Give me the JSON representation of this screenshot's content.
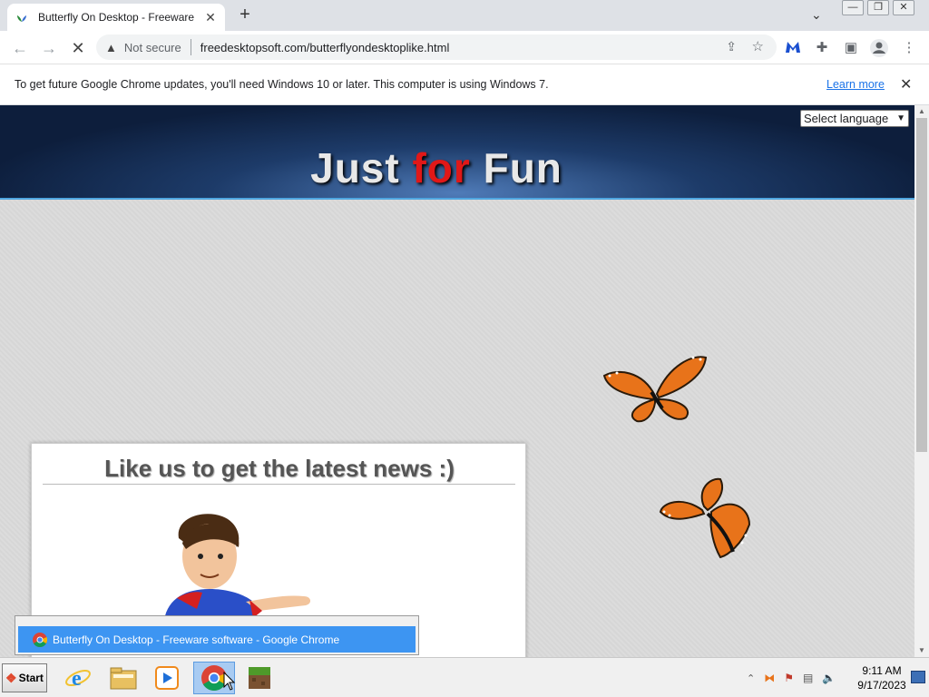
{
  "browser": {
    "tab_title": "Butterfly On Desktop - Freeware",
    "tab_close": "✕",
    "new_tab": "+",
    "tab_list": "⌄",
    "address_security": "Not secure",
    "address_url": "freedesktopsoft.com/butterflyondesktoplike.html"
  },
  "infobar": {
    "message": "To get future Google Chrome updates, you'll need Windows 10 or later. This computer is using Windows 7.",
    "link": "Learn more",
    "close": "✕"
  },
  "page": {
    "banner_words": [
      "Just",
      "for",
      "Fun"
    ],
    "language_select": "Select language",
    "card_heading": "Like us to get the latest news :)"
  },
  "tooltip": {
    "label": "Butterfly On Desktop - Freeware software - Google Chrome"
  },
  "taskbar": {
    "start_label": "Start",
    "clock_time": "9:11 AM",
    "clock_date": "9/17/2023"
  },
  "colors": {
    "banner_red": "#e01818",
    "butterfly_orange": "#e8731a",
    "link_blue": "#1a73e8",
    "taskbar_highlight": "#3d95f2"
  }
}
